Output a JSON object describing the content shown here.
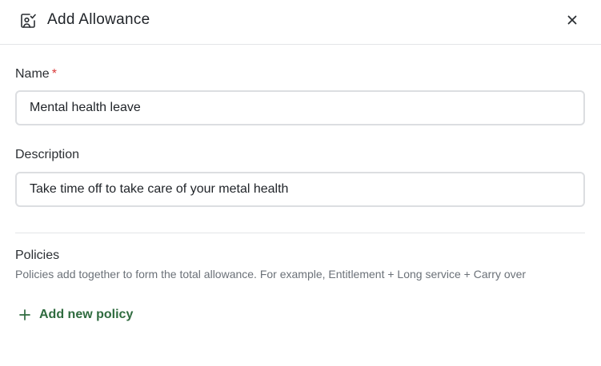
{
  "header": {
    "title": "Add Allowance",
    "icon": "allowance-icon",
    "close_icon": "close-icon"
  },
  "form": {
    "name": {
      "label": "Name",
      "required_marker": "*",
      "value": "Mental health leave"
    },
    "description": {
      "label": "Description",
      "value": "Take time off to take care of your metal health"
    }
  },
  "policies": {
    "title": "Policies",
    "help_text": "Policies add together to form the total allowance. For example, Entitlement + Long service + Carry over",
    "add_label": "Add new policy",
    "add_icon": "plus-icon"
  },
  "colors": {
    "accent_green": "#2f6b3f",
    "required_red": "#d93a3a",
    "border": "#dcdee1"
  }
}
